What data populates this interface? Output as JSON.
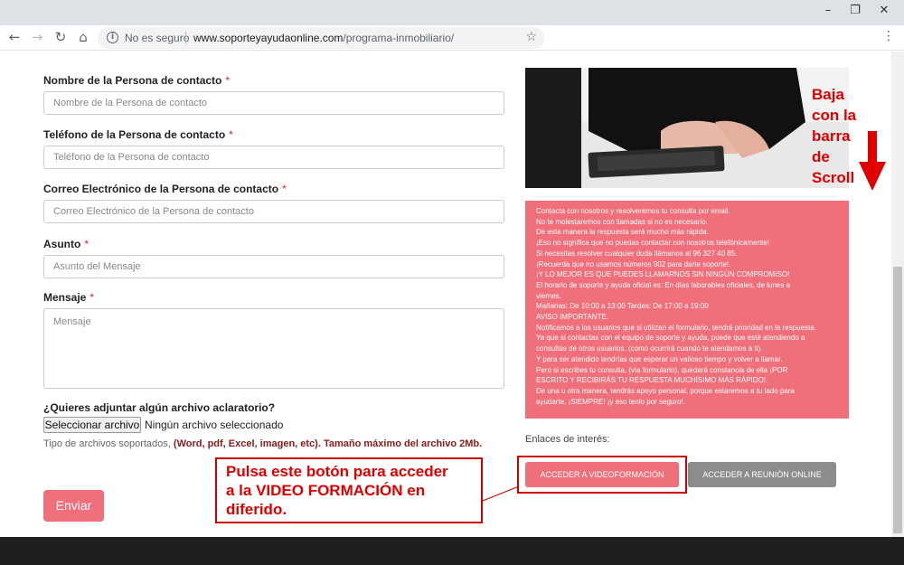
{
  "browser": {
    "security_text": "No es seguro",
    "url_host": "www.soporteyayudaonline.com",
    "url_path": "/programa-inmobiliario/"
  },
  "form": {
    "contact_name_label": "Nombre de la Persona de contacto",
    "contact_name_placeholder": "Nombre de la Persona de contacto",
    "phone_label": "Teléfono de la Persona de contacto",
    "phone_placeholder": "Teléfono de la Persona de contacto",
    "email_label": "Correo Electrónico de la Persona de contacto",
    "email_placeholder": "Correo Electrónico de la Persona de contacto",
    "subject_label": "Asunto",
    "subject_placeholder": "Asunto del Mensaje",
    "message_label": "Mensaje",
    "message_placeholder": "Mensaje",
    "required_mark": "*",
    "attach_label": "¿Quieres adjuntar algún archivo aclaratorio?",
    "file_button": "Seleccionar archivo",
    "file_status": "Ningún archivo seleccionado",
    "file_types_prefix": "Tipo de archivos soportados,",
    "file_types_bold": "(Word, pdf, Excel, imagen, etc). Tamaño máximo del archivo 2Mb.",
    "send_button": "Enviar"
  },
  "info_lines": [
    "Contacta con nosotros y resolveremos tu consulta por email.",
    "No te molestaremos con llamadas si no es necesario.",
    "De esta manera la respuesta será mucho más rápida.",
    "¡Eso no significa que no puedas contactar con nosotros telefónicamente!",
    "Si necesitas resolver cualquier duda llámanos al 96 327 40 85.",
    "¡Recuerda que no usamos números 902 para darte soporte!.",
    "¡Y LO MEJOR ES QUE PUEDES LLAMARNOS SIN NINGÚN COMPROMISO!",
    "El horario de soporte y ayuda oficial es: En días laborables oficiales, de lunes a",
    "viernes.",
    "Mañanas: De 10:00 a 13:00 Tardes: De 17:00 a 19:00",
    "AVISO IMPORTANTE.",
    "Notificamos a los usuarios que si utilizan el formulario, tendrá prioridad en la respuesta.",
    "Ya que si contactas con el equipo de soporte y ayuda, puede que esté atendiendo a",
    "consultas de otros usuarios, (como ocurrirá cuando te atendamos a ti).",
    "Y para ser atendido tendrías que esperar un valioso tiempo y volver a llamar.",
    "Pero si escribes tu consulta, (vía formulario), quedará constancia de ella ¡POR",
    "ESCRITO Y RECIBIRÁS TU RESPUESTA MUCHÍSIMO MÁS RÁPIDO!.",
    "De una u otra manera, tendrás apoyo personal, porque estaremos a tu lado para",
    "ayudarte, ¡SIEMPRE! ¡y eso tenlo por seguro!."
  ],
  "links": {
    "title": "Enlaces de interés:",
    "video_button": "ACCEDER A VIDEOFORMACIÓN",
    "meeting_button": "ACCEDER A REUNIÓN ONLINE"
  },
  "annotations": {
    "callout_lines": [
      "Pulsa este botón para acceder",
      "a la VIDEO FORMACIÓN en",
      "diferido."
    ],
    "scroll_note_lines": [
      "Baja",
      "con la",
      "barra",
      "de",
      "Scroll"
    ],
    "color": "#e00000"
  },
  "colors": {
    "accent": "#ef6f7a",
    "secondary_button": "#8c8c8c"
  }
}
